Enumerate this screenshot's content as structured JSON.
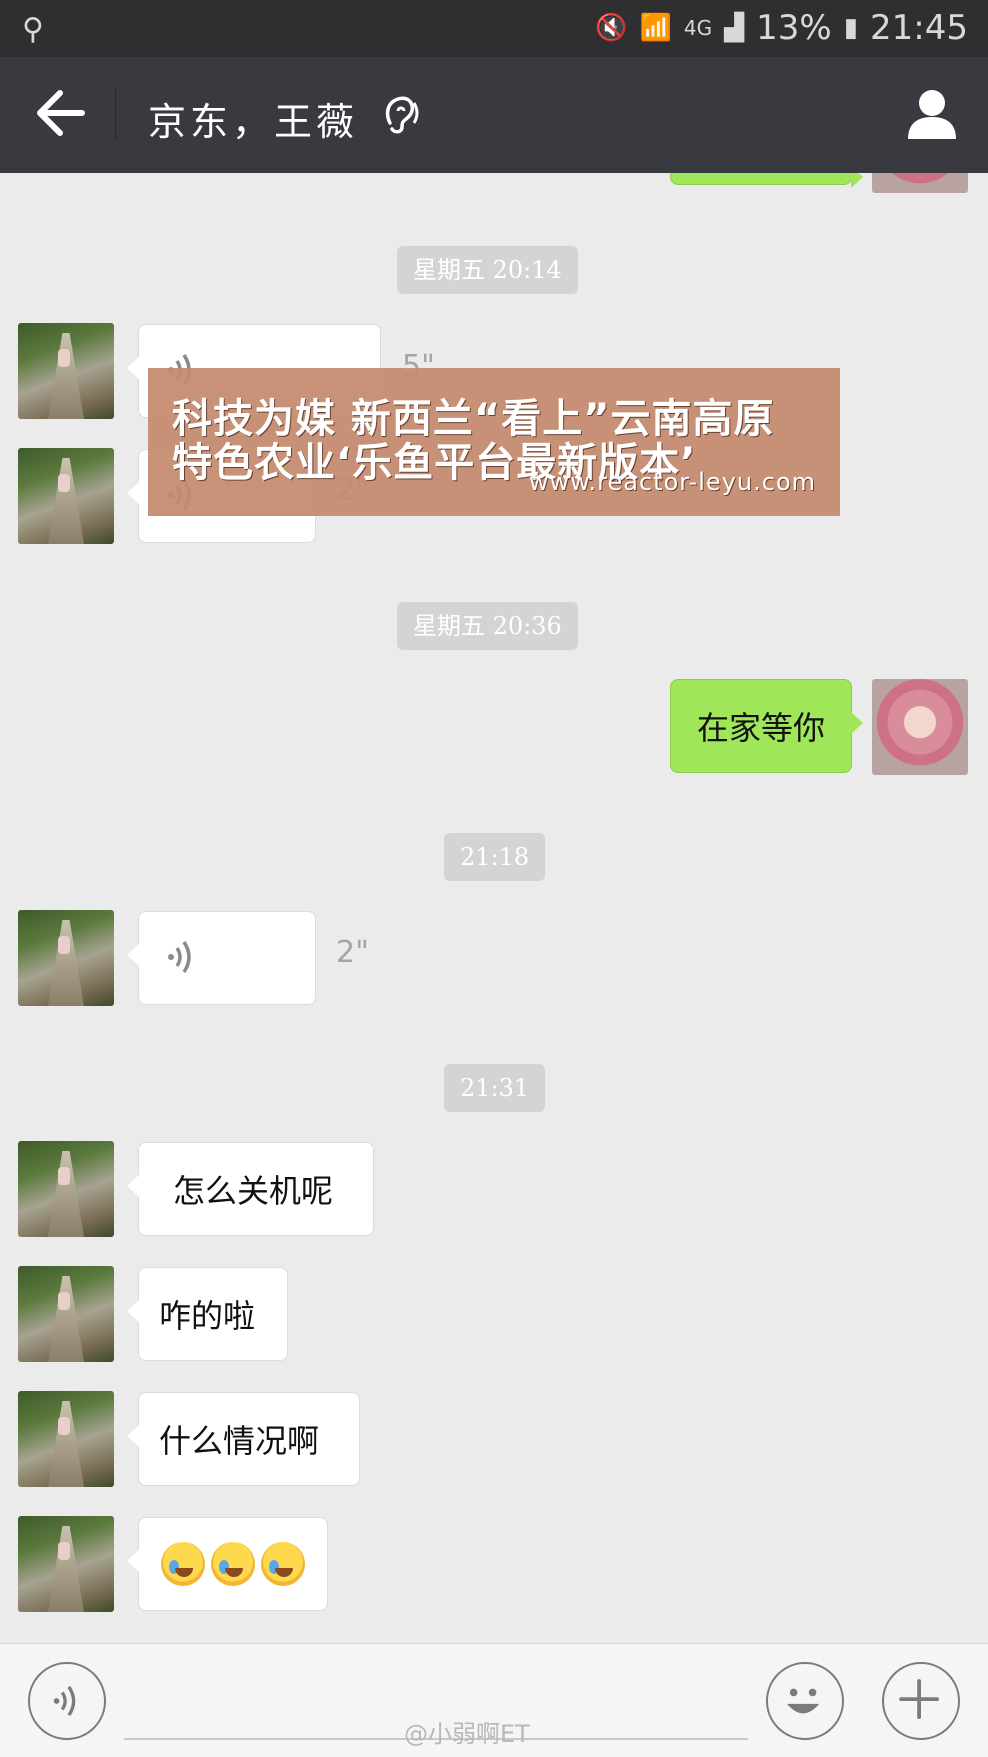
{
  "status_bar": {
    "battery": "13%",
    "time": "21:45",
    "network": "4G"
  },
  "nav": {
    "title": "京东，王薇"
  },
  "chat": {
    "timestamps": [
      "星期五 20:14",
      "星期五 20:36",
      "21:18",
      "21:31"
    ],
    "messages": [
      {
        "from": "other",
        "type": "voice",
        "duration": "5\""
      },
      {
        "from": "other",
        "type": "voice",
        "duration": "2\""
      },
      {
        "from": "me",
        "type": "text",
        "text": "在家等你"
      },
      {
        "from": "other",
        "type": "voice",
        "duration": "2\""
      },
      {
        "from": "other",
        "type": "text",
        "text": "怎么关机呢"
      },
      {
        "from": "other",
        "type": "text",
        "text": "咋的啦"
      },
      {
        "from": "other",
        "type": "text",
        "text": "什么情况啊"
      },
      {
        "from": "other",
        "type": "emoji",
        "emoji_names": [
          "face-with-tears-emoji",
          "face-with-tears-emoji",
          "face-with-tears-emoji"
        ]
      }
    ]
  },
  "overlay": {
    "line1": "科技为媒 新西兰“看上”云南高原",
    "line2": "特色农业‘乐鱼平台最新版本’",
    "url": "www.reactor-leyu.com"
  },
  "footer": {
    "credit": "@小弱啊ET"
  },
  "colors": {
    "nav_bg": "#393a3f",
    "status_bg": "#2f2f31",
    "chat_bg": "#ebebeb",
    "my_bubble": "#9fe658"
  }
}
